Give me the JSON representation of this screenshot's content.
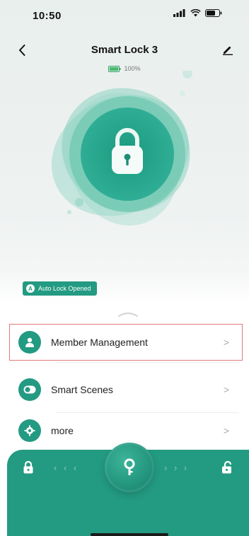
{
  "status_bar": {
    "time": "10:50"
  },
  "header": {
    "title": "Smart Lock 3"
  },
  "battery": {
    "level_text": "100%",
    "level": 1.0
  },
  "badge": {
    "icon_letter": "A",
    "text": "Auto Lock Opened"
  },
  "menu": {
    "items": [
      {
        "label": "Member Management",
        "icon": "person-icon"
      },
      {
        "label": "Smart Scenes",
        "icon": "toggle-icon"
      },
      {
        "label": "more",
        "icon": "gear-icon"
      }
    ],
    "chevron": ">"
  },
  "control": {
    "left_arrows": "‹ ‹ ‹",
    "right_arrows": "› › ›",
    "knob_icon": "key-icon",
    "left_icon": "lock-closed-icon",
    "right_icon": "lock-open-icon"
  },
  "colors": {
    "accent": "#239a82",
    "highlight_outline": "#e07a7a"
  }
}
